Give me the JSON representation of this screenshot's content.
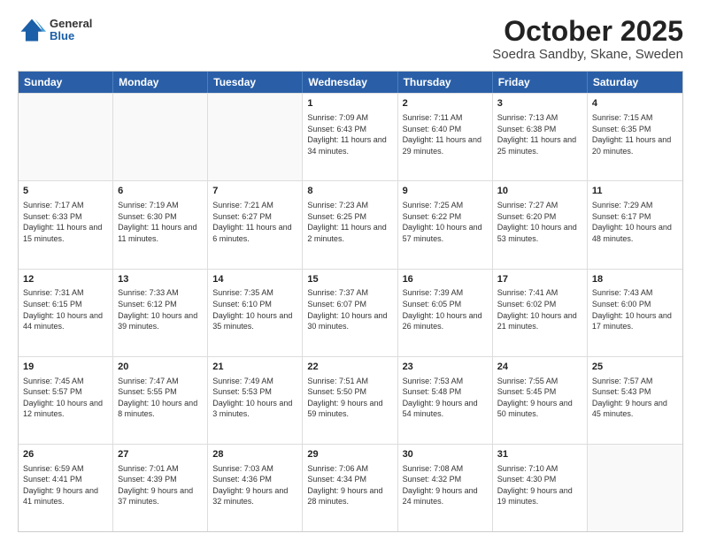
{
  "header": {
    "logo": {
      "general": "General",
      "blue": "Blue"
    },
    "title": "October 2025",
    "subtitle": "Soedra Sandby, Skane, Sweden"
  },
  "days_of_week": [
    "Sunday",
    "Monday",
    "Tuesday",
    "Wednesday",
    "Thursday",
    "Friday",
    "Saturday"
  ],
  "weeks": [
    [
      {
        "num": "",
        "info": ""
      },
      {
        "num": "",
        "info": ""
      },
      {
        "num": "",
        "info": ""
      },
      {
        "num": "1",
        "info": "Sunrise: 7:09 AM\nSunset: 6:43 PM\nDaylight: 11 hours\nand 34 minutes."
      },
      {
        "num": "2",
        "info": "Sunrise: 7:11 AM\nSunset: 6:40 PM\nDaylight: 11 hours\nand 29 minutes."
      },
      {
        "num": "3",
        "info": "Sunrise: 7:13 AM\nSunset: 6:38 PM\nDaylight: 11 hours\nand 25 minutes."
      },
      {
        "num": "4",
        "info": "Sunrise: 7:15 AM\nSunset: 6:35 PM\nDaylight: 11 hours\nand 20 minutes."
      }
    ],
    [
      {
        "num": "5",
        "info": "Sunrise: 7:17 AM\nSunset: 6:33 PM\nDaylight: 11 hours\nand 15 minutes."
      },
      {
        "num": "6",
        "info": "Sunrise: 7:19 AM\nSunset: 6:30 PM\nDaylight: 11 hours\nand 11 minutes."
      },
      {
        "num": "7",
        "info": "Sunrise: 7:21 AM\nSunset: 6:27 PM\nDaylight: 11 hours\nand 6 minutes."
      },
      {
        "num": "8",
        "info": "Sunrise: 7:23 AM\nSunset: 6:25 PM\nDaylight: 11 hours\nand 2 minutes."
      },
      {
        "num": "9",
        "info": "Sunrise: 7:25 AM\nSunset: 6:22 PM\nDaylight: 10 hours\nand 57 minutes."
      },
      {
        "num": "10",
        "info": "Sunrise: 7:27 AM\nSunset: 6:20 PM\nDaylight: 10 hours\nand 53 minutes."
      },
      {
        "num": "11",
        "info": "Sunrise: 7:29 AM\nSunset: 6:17 PM\nDaylight: 10 hours\nand 48 minutes."
      }
    ],
    [
      {
        "num": "12",
        "info": "Sunrise: 7:31 AM\nSunset: 6:15 PM\nDaylight: 10 hours\nand 44 minutes."
      },
      {
        "num": "13",
        "info": "Sunrise: 7:33 AM\nSunset: 6:12 PM\nDaylight: 10 hours\nand 39 minutes."
      },
      {
        "num": "14",
        "info": "Sunrise: 7:35 AM\nSunset: 6:10 PM\nDaylight: 10 hours\nand 35 minutes."
      },
      {
        "num": "15",
        "info": "Sunrise: 7:37 AM\nSunset: 6:07 PM\nDaylight: 10 hours\nand 30 minutes."
      },
      {
        "num": "16",
        "info": "Sunrise: 7:39 AM\nSunset: 6:05 PM\nDaylight: 10 hours\nand 26 minutes."
      },
      {
        "num": "17",
        "info": "Sunrise: 7:41 AM\nSunset: 6:02 PM\nDaylight: 10 hours\nand 21 minutes."
      },
      {
        "num": "18",
        "info": "Sunrise: 7:43 AM\nSunset: 6:00 PM\nDaylight: 10 hours\nand 17 minutes."
      }
    ],
    [
      {
        "num": "19",
        "info": "Sunrise: 7:45 AM\nSunset: 5:57 PM\nDaylight: 10 hours\nand 12 minutes."
      },
      {
        "num": "20",
        "info": "Sunrise: 7:47 AM\nSunset: 5:55 PM\nDaylight: 10 hours\nand 8 minutes."
      },
      {
        "num": "21",
        "info": "Sunrise: 7:49 AM\nSunset: 5:53 PM\nDaylight: 10 hours\nand 3 minutes."
      },
      {
        "num": "22",
        "info": "Sunrise: 7:51 AM\nSunset: 5:50 PM\nDaylight: 9 hours\nand 59 minutes."
      },
      {
        "num": "23",
        "info": "Sunrise: 7:53 AM\nSunset: 5:48 PM\nDaylight: 9 hours\nand 54 minutes."
      },
      {
        "num": "24",
        "info": "Sunrise: 7:55 AM\nSunset: 5:45 PM\nDaylight: 9 hours\nand 50 minutes."
      },
      {
        "num": "25",
        "info": "Sunrise: 7:57 AM\nSunset: 5:43 PM\nDaylight: 9 hours\nand 45 minutes."
      }
    ],
    [
      {
        "num": "26",
        "info": "Sunrise: 6:59 AM\nSunset: 4:41 PM\nDaylight: 9 hours\nand 41 minutes."
      },
      {
        "num": "27",
        "info": "Sunrise: 7:01 AM\nSunset: 4:39 PM\nDaylight: 9 hours\nand 37 minutes."
      },
      {
        "num": "28",
        "info": "Sunrise: 7:03 AM\nSunset: 4:36 PM\nDaylight: 9 hours\nand 32 minutes."
      },
      {
        "num": "29",
        "info": "Sunrise: 7:06 AM\nSunset: 4:34 PM\nDaylight: 9 hours\nand 28 minutes."
      },
      {
        "num": "30",
        "info": "Sunrise: 7:08 AM\nSunset: 4:32 PM\nDaylight: 9 hours\nand 24 minutes."
      },
      {
        "num": "31",
        "info": "Sunrise: 7:10 AM\nSunset: 4:30 PM\nDaylight: 9 hours\nand 19 minutes."
      },
      {
        "num": "",
        "info": ""
      }
    ]
  ]
}
